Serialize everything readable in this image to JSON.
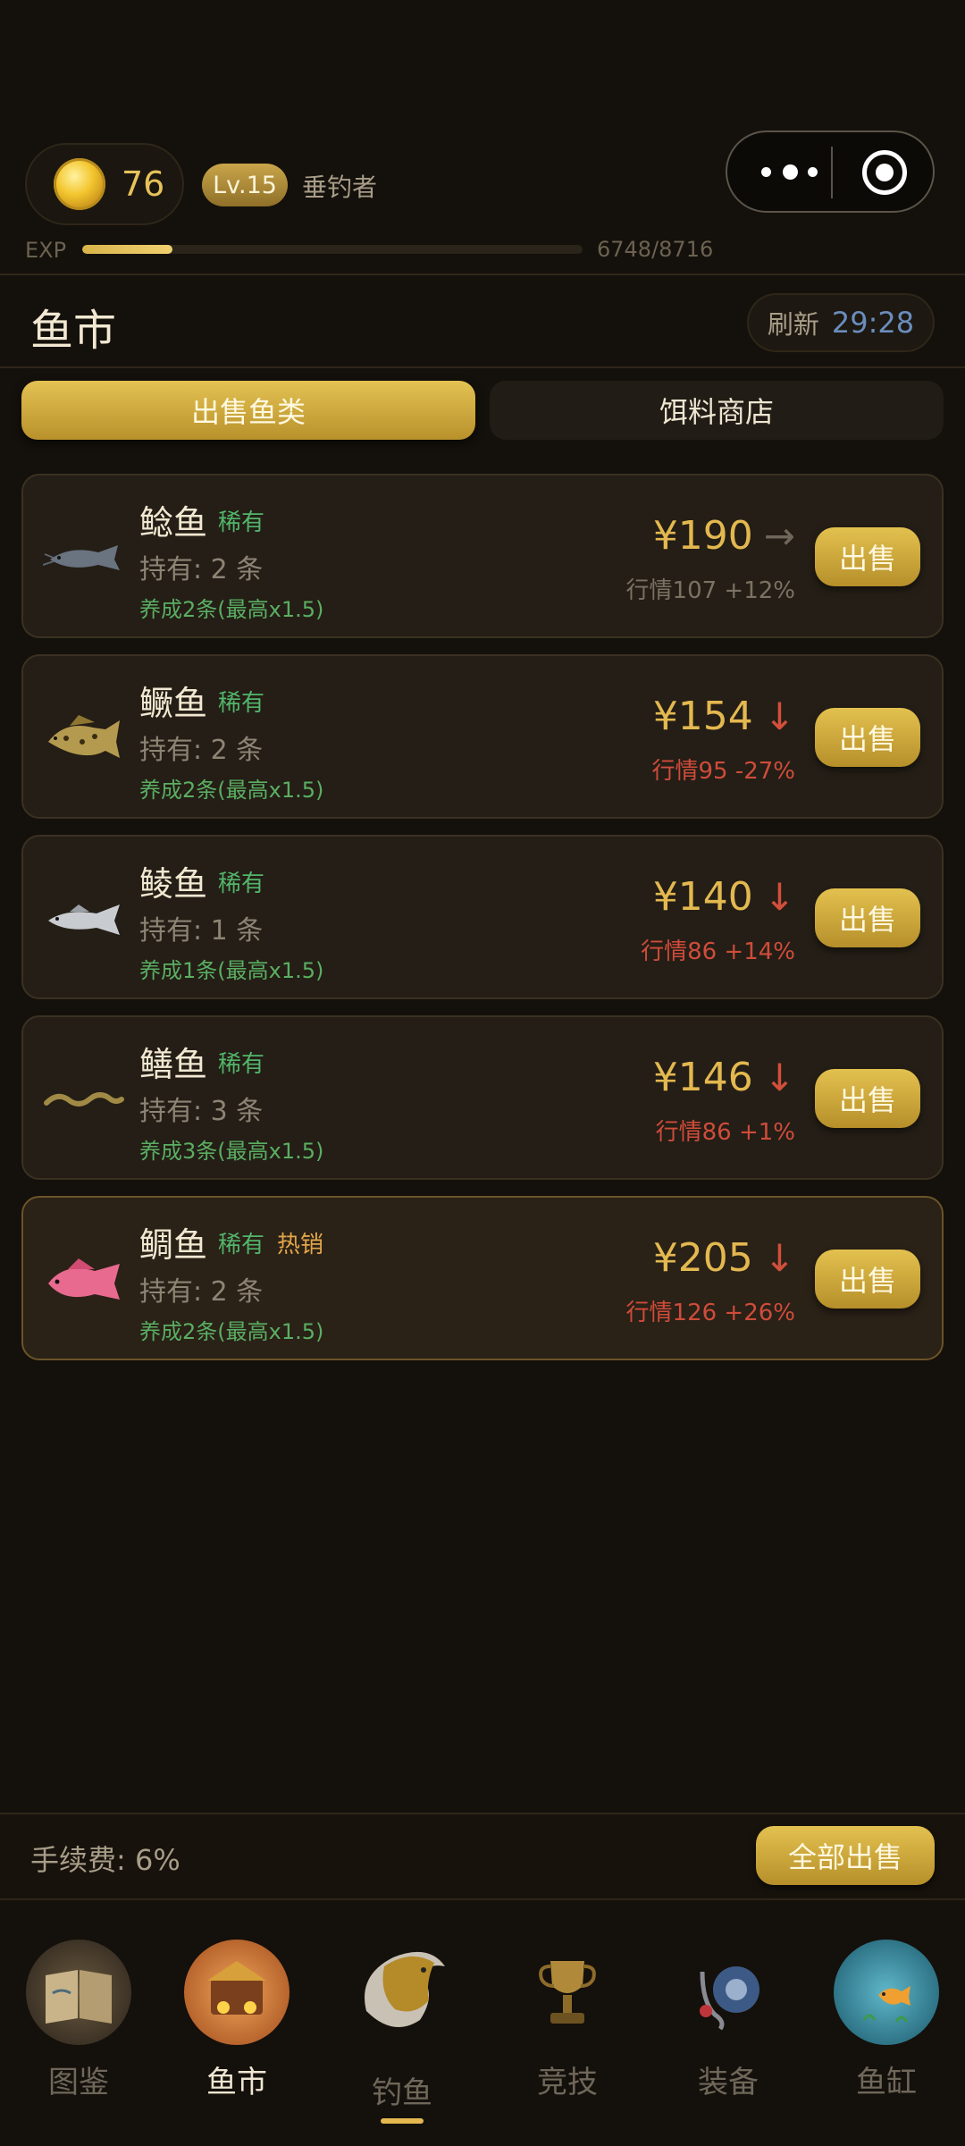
{
  "header": {
    "coins": "76",
    "level": "Lv.15",
    "rank_title": "垂钓者",
    "exp_label": "EXP",
    "exp_text": "6748/8716",
    "exp_progress": 0.18
  },
  "page": {
    "title": "鱼市",
    "refresh_label": "刷新",
    "refresh_time": "29:28"
  },
  "tabs": [
    {
      "label": "出售鱼类",
      "active": true
    },
    {
      "label": "饵料商店",
      "active": false
    }
  ],
  "fish": [
    {
      "name": "鲶鱼",
      "tags": [
        "稀有"
      ],
      "hold": "持有: 2 条",
      "raise": "养成2条(最高x1.5)",
      "price": "¥190",
      "trend": "→",
      "trend_type": "flat",
      "market": "行情107 +12%",
      "sell": "出售",
      "icon": "catfish-icon"
    },
    {
      "name": "鳜鱼",
      "tags": [
        "稀有"
      ],
      "hold": "持有: 2 条",
      "raise": "养成2条(最高x1.5)",
      "price": "¥154",
      "trend": "↓",
      "trend_type": "down",
      "market": "行情95 -27%",
      "sell": "出售",
      "icon": "mandarin-fish-icon"
    },
    {
      "name": "鲮鱼",
      "tags": [
        "稀有"
      ],
      "hold": "持有: 1 条",
      "raise": "养成1条(最高x1.5)",
      "price": "¥140",
      "trend": "↓",
      "trend_type": "down",
      "market": "行情86 +14%",
      "sell": "出售",
      "icon": "mud-carp-icon"
    },
    {
      "name": "鳝鱼",
      "tags": [
        "稀有"
      ],
      "hold": "持有: 3 条",
      "raise": "养成3条(最高x1.5)",
      "price": "¥146",
      "trend": "↓",
      "trend_type": "down",
      "market": "行情86 +1%",
      "sell": "出售",
      "icon": "eel-icon"
    },
    {
      "name": "鲷鱼",
      "tags": [
        "稀有",
        "热销"
      ],
      "hold": "持有: 2 条",
      "raise": "养成2条(最高x1.5)",
      "price": "¥205",
      "trend": "↓",
      "trend_type": "down",
      "market": "行情126 +26%",
      "sell": "出售",
      "icon": "sea-bream-icon"
    }
  ],
  "footer": {
    "fee": "手续费: 6%",
    "sell_all": "全部出售"
  },
  "nav": [
    {
      "label": "图鉴",
      "icon": "book-icon"
    },
    {
      "label": "鱼市",
      "icon": "market-icon",
      "active": true
    },
    {
      "label": "钓鱼",
      "icon": "fishing-icon"
    },
    {
      "label": "竞技",
      "icon": "trophy-icon"
    },
    {
      "label": "装备",
      "icon": "reel-icon"
    },
    {
      "label": "鱼缸",
      "icon": "fishbowl-icon"
    }
  ]
}
